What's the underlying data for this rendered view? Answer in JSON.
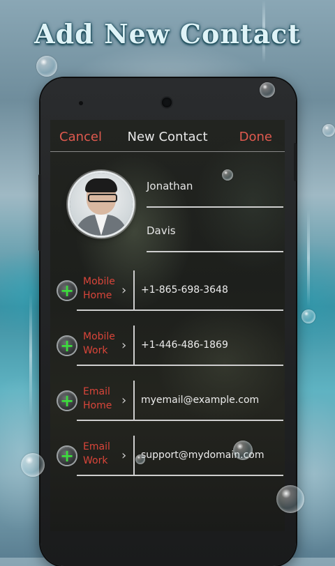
{
  "promo": {
    "headline": "Add New Contact"
  },
  "topbar": {
    "cancel_label": "Cancel",
    "title": "New Contact",
    "done_label": "Done"
  },
  "contact": {
    "first_name": "Jonathan",
    "last_name": "Davis"
  },
  "fields": [
    {
      "label_line1": "Mobile",
      "label_line2": "Home",
      "value": "+1-865-698-3648"
    },
    {
      "label_line1": "Mobile",
      "label_line2": "Work",
      "value": "+1-446-486-1869"
    },
    {
      "label_line1": "Email",
      "label_line2": "Home",
      "value": "myemail@example.com"
    },
    {
      "label_line1": "Email",
      "label_line2": "Work",
      "value": "support@mydomain.com"
    }
  ],
  "icons": {
    "add": "plus-icon",
    "chevron": "chevron-right-icon"
  },
  "colors": {
    "accent": "#e05a4f",
    "add_green": "#3ddc3d",
    "label_red": "#d9453a"
  }
}
